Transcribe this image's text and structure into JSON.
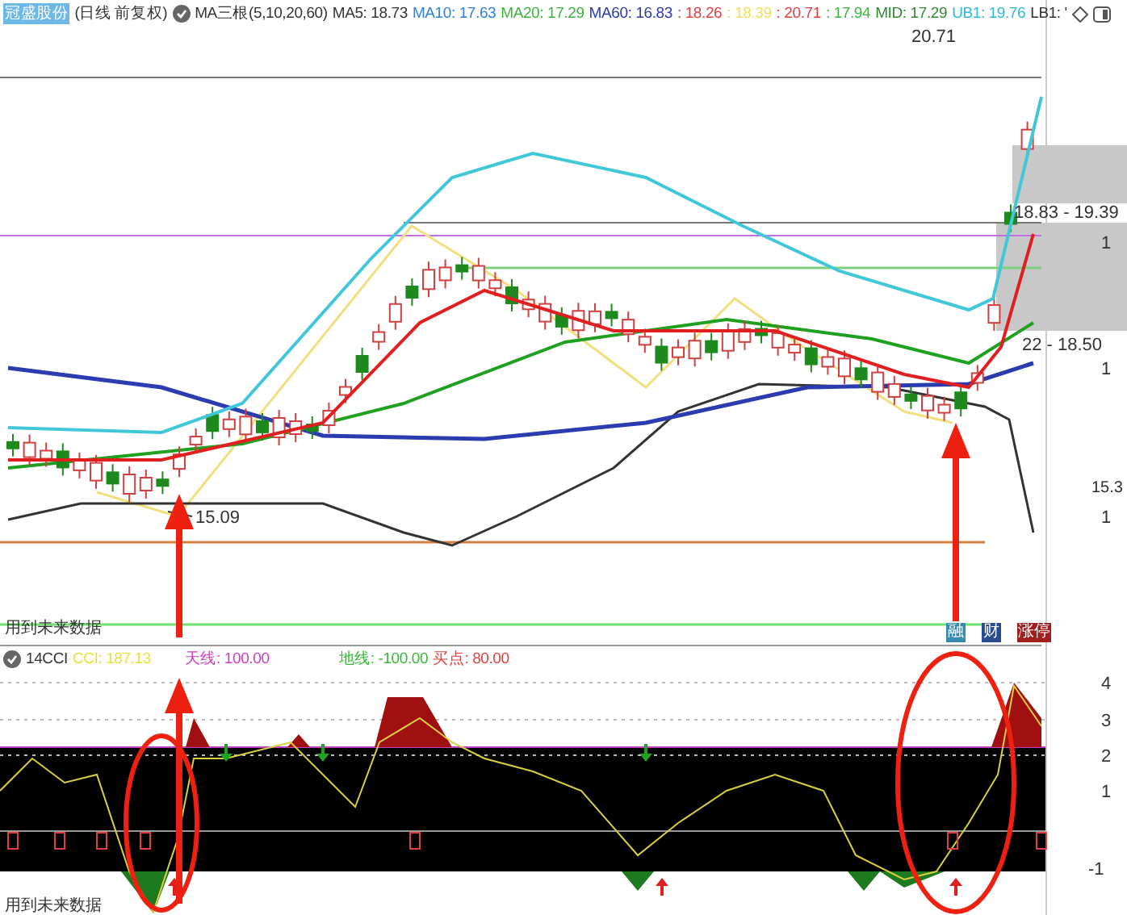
{
  "price_header": {
    "name": "冠盛股份",
    "period": "(日线 前复权)",
    "indicator": "MA三根(5,10,20,60)",
    "values": [
      {
        "label": "MA5: 18.73",
        "color": "#333333"
      },
      {
        "label": "MA10: 17.63",
        "color": "#2f7fd8"
      },
      {
        "label": "MA20: 17.29",
        "color": "#3cb43c"
      },
      {
        "label": "MA60: 16.83",
        "color": "#2a3cb0"
      },
      {
        "label": ": 18.26",
        "color": "#e04040"
      },
      {
        "label": ": 18.39",
        "color": "#f0e060"
      },
      {
        "label": ": 20.71",
        "color": "#e04040"
      },
      {
        "label": ": 17.94",
        "color": "#3cb43c"
      },
      {
        "label": "MID: 17.29",
        "color": "#2e8b2e"
      },
      {
        "label": "UB1: 19.76",
        "color": "#30b8d8"
      },
      {
        "label": "LB1: '",
        "color": "#333333"
      }
    ]
  },
  "price_chart": {
    "labels": [
      "20.71",
      "18.83 - 19.39",
      "22 - 18.50",
      "15.09"
    ],
    "axis_labels": [
      "1",
      "1",
      "15.3",
      "1"
    ],
    "note": "用到未来数据",
    "badges": [
      "融",
      "财",
      "涨停"
    ]
  },
  "cci_header": {
    "name": "14CCI",
    "values": [
      {
        "label": "CCI: 187.13",
        "color": "#e8e040"
      },
      {
        "label": "天线: 100.00",
        "color": "#d040c0"
      },
      {
        "label": "地线: -100.00",
        "color": "#3cb43c"
      },
      {
        "label": "买点: 80.00",
        "color": "#e04040"
      }
    ]
  },
  "cci_chart": {
    "axis_labels": [
      "4",
      "3",
      "2",
      "1",
      "-1"
    ],
    "note": "用到未来数据"
  }
}
